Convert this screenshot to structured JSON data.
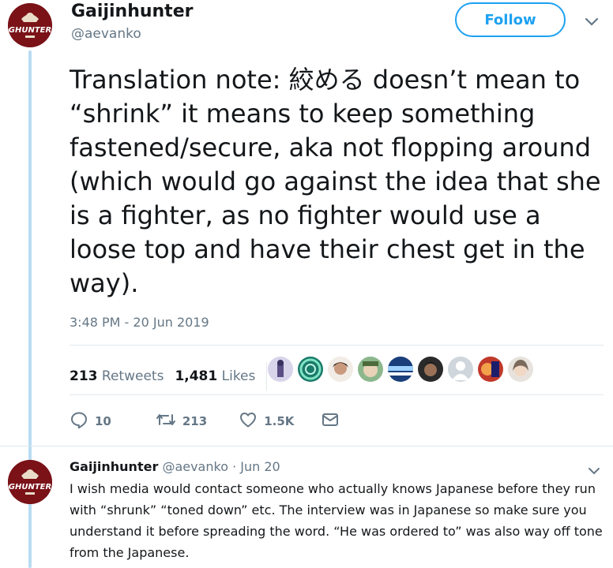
{
  "main_tweet": {
    "author_name": "Gaijinhunter",
    "author_handle": "@aevanko",
    "avatar_text": "GHUNTER",
    "follow_label": "Follow",
    "text": "Translation note: 絞める doesn’t mean to “shrink” it means to keep something fastened/secure, aka not flopping around (which would go against the idea that she is a fighter, as no fighter would use a loose top and have their chest get in the way).",
    "timestamp": "3:48 PM - 20 Jun 2019",
    "retweet_count": "213",
    "retweet_label": "Retweets",
    "like_count": "1,481",
    "like_label": "Likes",
    "actions": {
      "reply_count": "10",
      "retweet_count": "213",
      "like_count": "1.5K"
    }
  },
  "reply": {
    "author_name": "Gaijinhunter",
    "author_handle": "@aevanko",
    "date": "Jun 20",
    "text": "I wish media would contact someone who actually knows Japanese before they run with “shrunk” “toned down” etc. The interview was in Japanese so make sure you understand it before spreading the word. “He was ordered to” was also way off tone from the Japanese."
  },
  "colors": {
    "accent": "#1da1f2",
    "thread_line": "#b9dcf2",
    "muted": "#657786",
    "avatar_bg": "#7a1218"
  }
}
